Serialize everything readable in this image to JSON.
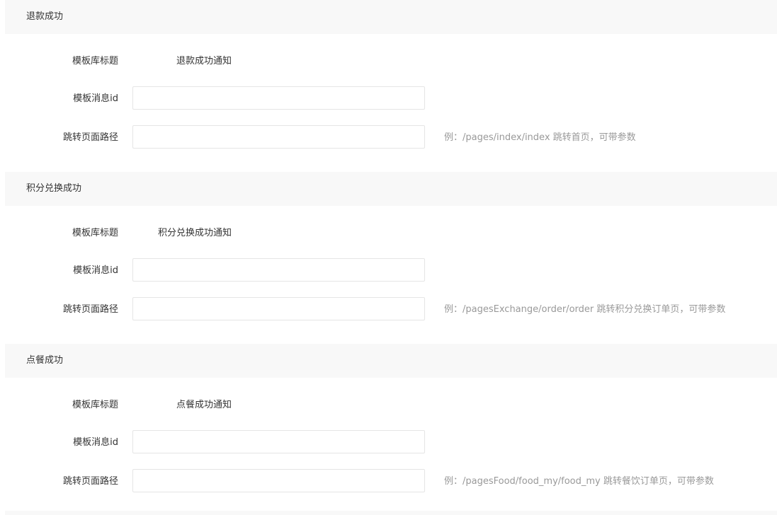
{
  "labels": {
    "template_title": "模板库标题",
    "template_id": "模板消息id",
    "page_path": "跳转页面路径"
  },
  "sections": [
    {
      "title": "退款成功",
      "template_title_value": "退款成功通知",
      "template_id_value": "",
      "page_path_value": "",
      "hint": "例：/pages/index/index 跳转首页，可带参数"
    },
    {
      "title": "积分兑换成功",
      "template_title_value": "积分兑换成功通知",
      "template_id_value": "",
      "page_path_value": "",
      "hint": "例：/pagesExchange/order/order 跳转积分兑换订单页，可带参数"
    },
    {
      "title": "点餐成功",
      "template_title_value": "点餐成功通知",
      "template_id_value": "",
      "page_path_value": "",
      "hint": "例：/pagesFood/food_my/food_my 跳转餐饮订单页，可带参数"
    }
  ]
}
